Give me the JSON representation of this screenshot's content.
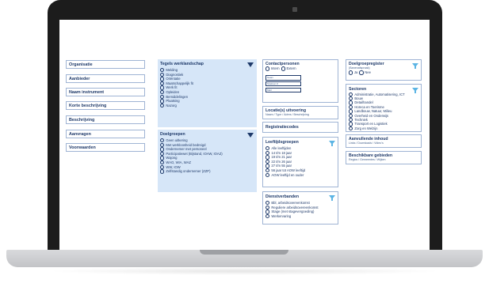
{
  "nav": [
    "Organisatie",
    "Aanbieder",
    "Naam instrument",
    "Korte beschrijving",
    "Beschrijving",
    "Aanvragen",
    "Voorwaarden"
  ],
  "tegels": {
    "title": "Tegels werklandschap",
    "options": [
      "Melding",
      "Diagnostiek",
      "Oriëntatie",
      "Maatschappelijk fit",
      "Werk fit",
      "Opleiden",
      "Bemiddelingen",
      "Plaatsing",
      "Nazorg"
    ]
  },
  "doelgroepen": {
    "title": "Doelgroepen",
    "options": [
      "Geen uitkering",
      "Met werkloosheid bedreigd",
      "Ondernemer met personeel",
      "Participatiewet (Bijstand, IOAW, IOAZ)",
      "Wajong",
      "WAO, WIA, WAZ",
      "WW, IOW",
      "Zelfstandig ondernemer (ZZP)"
    ]
  },
  "contact": {
    "title": "Contactpersonen",
    "options": [
      "Intern",
      "Extern"
    ],
    "fields": [
      "Naam",
      "Telefoon #",
      "Mail"
    ]
  },
  "locatie": {
    "title": "Locatie(s) uitvoering",
    "sub": "Naam / Type / Adres / Beschrijving"
  },
  "registratie": {
    "title": "Registratiecodes"
  },
  "leeftijd": {
    "title": "Leeftijdsgroepen",
    "options": [
      "Alle leeftijden",
      "14 t/m 18 jaar",
      "19 t/m 21 jaar",
      "22 t/m 26 jaar",
      "27 t/m 55 jaar",
      "56 jaar tot AOW leeftijd",
      "AOW leeftijd en ouder"
    ]
  },
  "dienst": {
    "title": "Dienstverbanden",
    "options": [
      "Bbl, arbeidsovereenkomst",
      "Reguliere arbeidsovereenkomst",
      "Stage (met stagevergoeding)",
      "Werkervaring"
    ]
  },
  "doelgroepregister": {
    "title": "Doelgroepregister",
    "sub": "(Banenafspraak)",
    "options": [
      "Ja",
      "Nee"
    ]
  },
  "sectoren": {
    "title": "Sectoren",
    "options": [
      "Administratie, Automatisering, ICT",
      "Bouw",
      "Detailhandel",
      "Horeca en Toerisme",
      "Landbouw, Natuur, Milieu",
      "Overheid en Onderwijs",
      "Techniek",
      "Transport en Logistiek",
      "Zorg en Welzijn"
    ]
  },
  "aanvullend": {
    "title": "Aanvullende inhoud",
    "sub": "Links / Downloads / Video's"
  },
  "gebieden": {
    "title": "Beschikbare gebieden",
    "sub": "Regios / Gemeentes / Wijken"
  },
  "colors": {
    "panel_blue": "#d6e6f8",
    "text_navy": "#1f3a6a",
    "filter_blue": "#5bb4e4"
  },
  "icons": {
    "dropdown": "triangle-down-icon",
    "filter": "funnel-icon",
    "radio": "radio-circle-icon"
  }
}
